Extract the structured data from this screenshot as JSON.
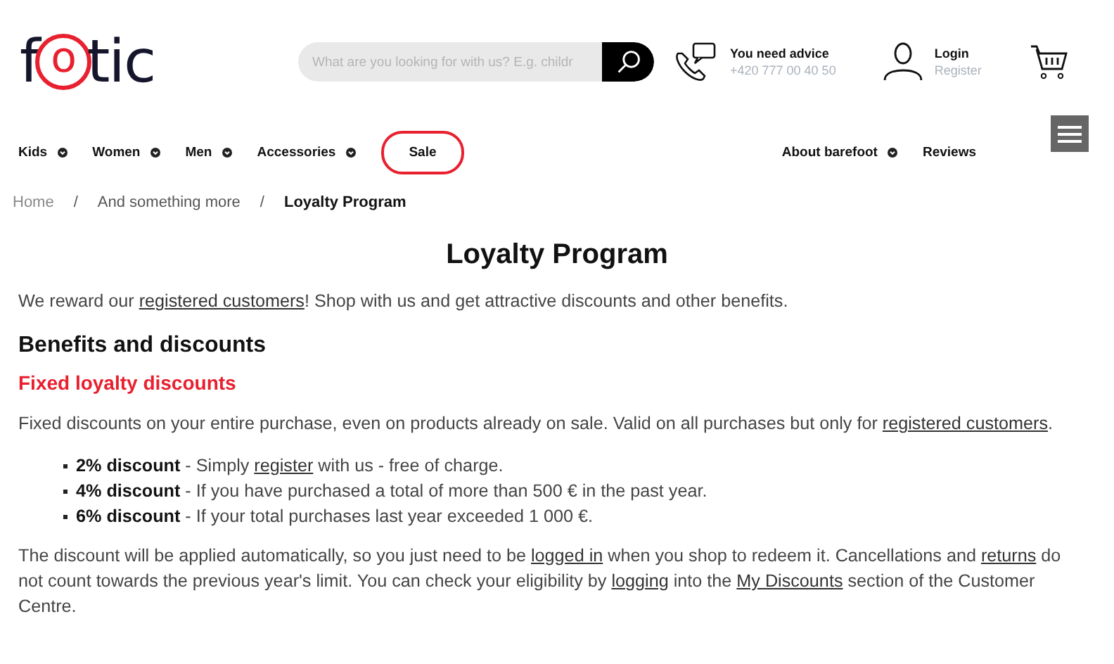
{
  "logo": "fotic",
  "search": {
    "placeholder": "What are you looking for with us? E.g. childr"
  },
  "advice": {
    "title": "You need advice",
    "phone": "+420 777 00 40 50"
  },
  "account": {
    "login": "Login",
    "register": "Register"
  },
  "nav_left": [
    {
      "label": "Kids",
      "kind": "dropdown"
    },
    {
      "label": "Women",
      "kind": "dropdown"
    },
    {
      "label": "Men",
      "kind": "dropdown"
    },
    {
      "label": "Accessories",
      "kind": "dropdown"
    },
    {
      "label": "Sale",
      "kind": "outlined"
    }
  ],
  "nav_right": [
    {
      "label": "About barefoot",
      "kind": "dropdown"
    },
    {
      "label": "Reviews",
      "kind": "plain"
    }
  ],
  "breadcrumb": [
    {
      "label": "Home",
      "current": false
    },
    {
      "label": "And something more",
      "current": false
    },
    {
      "label": "Loyalty Program",
      "current": true
    }
  ],
  "breadcrumb_separator": "/",
  "title": "Loyalty Program",
  "intro": [
    {
      "kind": "text",
      "text": "We reward our "
    },
    {
      "kind": "link",
      "text": "registered customers"
    },
    {
      "kind": "text",
      "text": "! Shop with us and get attractive discounts and other benefits."
    }
  ],
  "section_heading": "Benefits and discounts",
  "subheading": "Fixed loyalty discounts",
  "description": [
    {
      "kind": "text",
      "text": "Fixed discounts on your entire purchase, even on products already on sale. Valid on all purchases but only for "
    },
    {
      "kind": "link",
      "text": "registered customers"
    },
    {
      "kind": "text",
      "text": "."
    }
  ],
  "discounts": [
    [
      {
        "kind": "bold",
        "text": "2% discount"
      },
      {
        "kind": "text",
        "text": " - Simply "
      },
      {
        "kind": "link",
        "text": "register"
      },
      {
        "kind": "text",
        "text": " with us - free of charge."
      }
    ],
    [
      {
        "kind": "bold",
        "text": "4% discount"
      },
      {
        "kind": "text",
        "text": " - If you have purchased a total of more than 500 € in the past year."
      }
    ],
    [
      {
        "kind": "bold",
        "text": "6% discount"
      },
      {
        "kind": "text",
        "text": " - If your total purchases last year exceeded 1 000 €."
      }
    ]
  ],
  "note": [
    {
      "kind": "text",
      "text": "The discount will be applied automatically, so you just need to be "
    },
    {
      "kind": "link",
      "text": "logged in"
    },
    {
      "kind": "text",
      "text": " when you shop to redeem it. Cancellations and "
    },
    {
      "kind": "link",
      "text": "returns"
    },
    {
      "kind": "text",
      "text": " do not count towards the previous year's limit. You can check your eligibility by "
    },
    {
      "kind": "link",
      "text": "logging"
    },
    {
      "kind": "text",
      "text": " into the "
    },
    {
      "kind": "link",
      "text": "My Discounts"
    },
    {
      "kind": "text",
      "text": " section of the Customer Centre."
    }
  ]
}
